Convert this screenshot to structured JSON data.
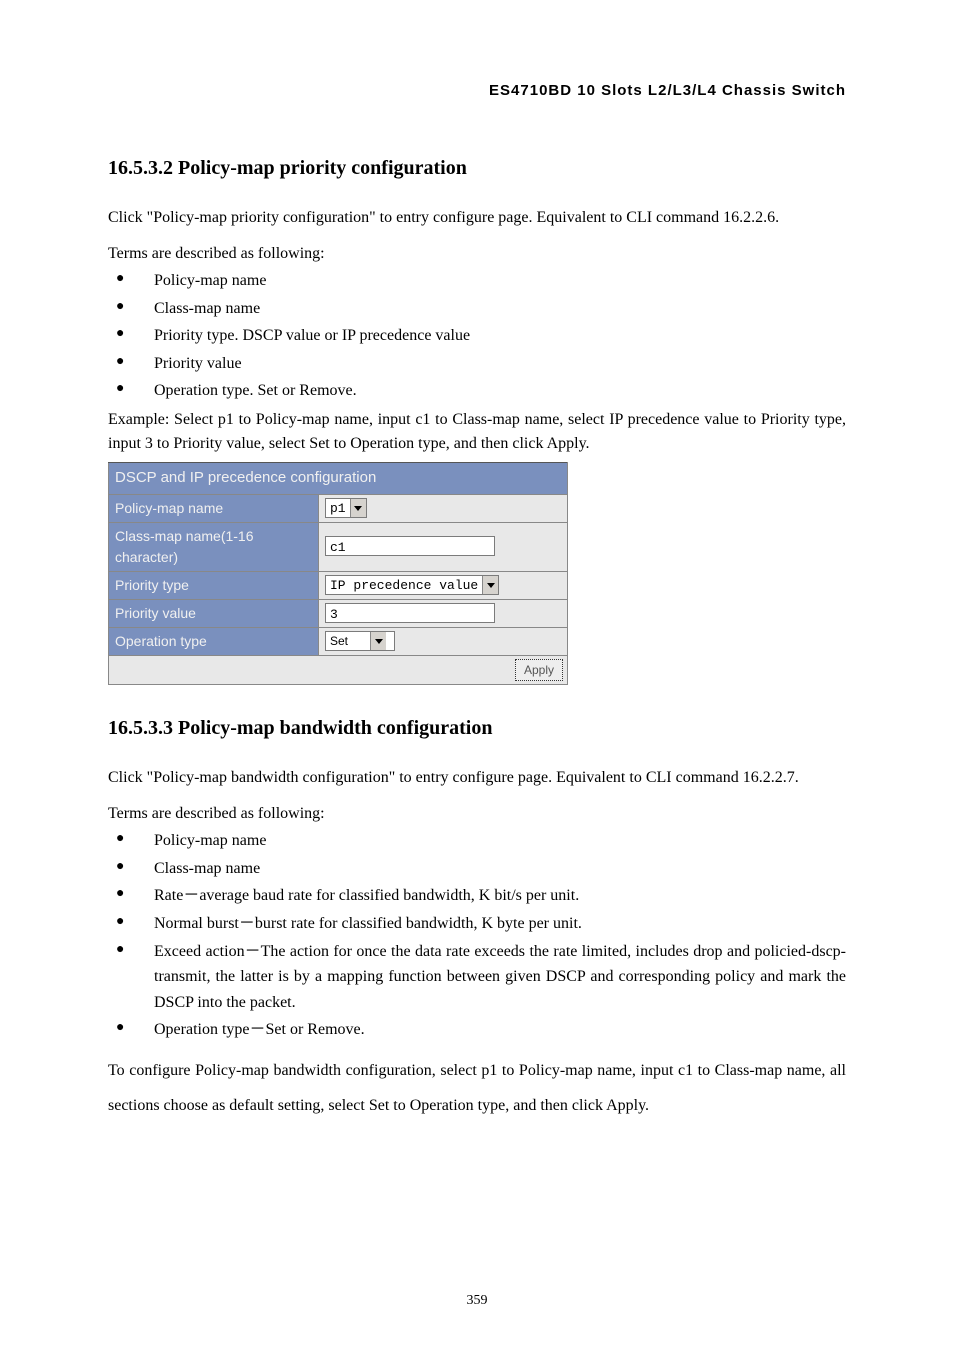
{
  "header": "ES4710BD 10 Slots L2/L3/L4 Chassis Switch",
  "sec1": {
    "heading": "16.5.3.2 Policy-map priority configuration",
    "para1": "Click \"Policy-map priority configuration\" to entry configure page. Equivalent to CLI command 16.2.2.6.",
    "termsIntro": "Terms are described as following:",
    "bullets": [
      "Policy-map name",
      "Class-map name",
      "Priority type. DSCP value or IP precedence value",
      "Priority value",
      "Operation type. Set or Remove."
    ],
    "example": "Example: Select p1 to Policy-map name, input c1 to Class-map name, select IP precedence value to Priority type, input 3 to Priority value, select Set to Operation type, and then click Apply."
  },
  "table": {
    "title": "DSCP and IP precedence configuration",
    "rows": {
      "policyMap": {
        "label": "Policy-map name",
        "value": "p1"
      },
      "classMap": {
        "label": "Class-map name(1-16 character)",
        "value": "c1"
      },
      "priorityType": {
        "label": "Priority type",
        "value": "IP precedence value"
      },
      "priorityValue": {
        "label": "Priority value",
        "value": "3"
      },
      "operationType": {
        "label": "Operation type",
        "value": "Set"
      }
    },
    "apply": "Apply"
  },
  "sec2": {
    "heading": "16.5.3.3 Policy-map bandwidth configuration",
    "para1": "Click \"Policy-map bandwidth configuration\" to entry configure page. Equivalent to CLI command 16.2.2.7.",
    "termsIntro": "Terms are described as following:",
    "bullets": [
      {
        "text": "Policy-map name"
      },
      {
        "text": "Class-map name"
      },
      {
        "text": "Rate－average baud rate for classified bandwidth, K bit/s per unit."
      },
      {
        "text": "Normal burst－burst rate for classified bandwidth, K byte per unit."
      },
      {
        "text": "Exceed action－The action for once the data rate exceeds the rate limited, includes drop and policied-dscp-transmit, the latter is by a mapping function between given DSCP and corresponding policy and mark the DSCP into the packet."
      },
      {
        "text": "Operation type－Set or Remove."
      }
    ],
    "para2": "To configure Policy-map bandwidth configuration, select p1 to Policy-map name, input c1 to Class-map name, all sections choose as default setting, select Set to Operation type, and then click Apply."
  },
  "pageNumber": "359"
}
